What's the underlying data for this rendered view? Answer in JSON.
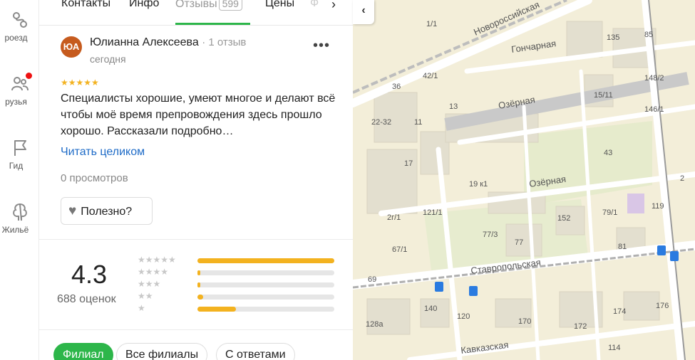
{
  "rail": {
    "items": [
      {
        "label": "роезд",
        "icon": "route-icon"
      },
      {
        "label": "рузья",
        "icon": "friends-icon",
        "badge": true
      },
      {
        "label": "Гид",
        "icon": "flag-icon"
      },
      {
        "label": "Жильё",
        "icon": "housing-icon"
      }
    ]
  },
  "tabs": {
    "items": [
      "Контакты",
      "Инфо",
      "Отзывы",
      "Цены",
      "Ф"
    ],
    "reviews_count": "599",
    "active": "Отзывы",
    "next_icon": "chevron-right-icon"
  },
  "review": {
    "avatar_initials": "ЮА",
    "author": "Юлианна Алексеева",
    "author_meta": "1 отзыв",
    "date": "сегодня",
    "stars": "★★★★★",
    "text": "Специалисты хорошие, умеют многое и делают всё чтобы моё время препровождения здесь прошло хорошо. Рассказали подробно…",
    "read_more": "Читать целиком",
    "views": "0 просмотров",
    "useful": "Полезно?"
  },
  "rating": {
    "score": "4.3",
    "count": "688 оценок",
    "distribution": [
      {
        "stars": "★★★★★",
        "fraction": 1.0
      },
      {
        "stars": "★★★★",
        "fraction": 0.02
      },
      {
        "stars": "★★★",
        "fraction": 0.02
      },
      {
        "stars": "★★",
        "fraction": 0.04
      },
      {
        "stars": "★",
        "fraction": 0.28
      }
    ]
  },
  "filters": [
    "Филиал",
    "Все филиалы",
    "С ответами"
  ],
  "map": {
    "streets": [
      "Новороссийская",
      "Гончарная",
      "Озёрная",
      "Озёрная",
      "Ставропольская",
      "Кавказская"
    ],
    "numbers": [
      "1/1",
      "135",
      "85",
      "42/1",
      "36",
      "15/11",
      "148/2",
      "13",
      "146/1",
      "22-32",
      "11",
      "17",
      "43",
      "19 к1",
      "2г/1",
      "121/1",
      "152",
      "79/1",
      "119",
      "77/3",
      "77",
      "81",
      "67/1",
      "69",
      "140",
      "120",
      "170",
      "174",
      "176",
      "128а",
      "172",
      "114",
      "2"
    ],
    "colors": {
      "bg": "#f3eed9",
      "road": "#ffffff",
      "rail": "#bdbdbd",
      "block": "#e3dfcf",
      "park": "#dfe8c4"
    }
  }
}
